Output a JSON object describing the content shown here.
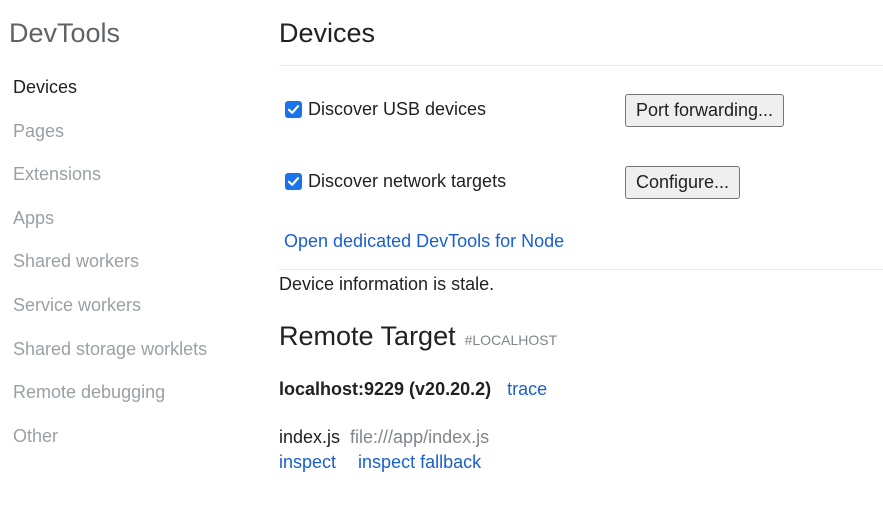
{
  "sidebar": {
    "title": "DevTools",
    "items": [
      {
        "label": "Devices",
        "selected": true
      },
      {
        "label": "Pages"
      },
      {
        "label": "Extensions"
      },
      {
        "label": "Apps"
      },
      {
        "label": "Shared workers"
      },
      {
        "label": "Service workers"
      },
      {
        "label": "Shared storage worklets"
      },
      {
        "label": "Remote debugging"
      },
      {
        "label": "Other"
      }
    ]
  },
  "main": {
    "title": "Devices",
    "usb": {
      "label": "Discover USB devices",
      "checked": true,
      "button": "Port forwarding..."
    },
    "network": {
      "label": "Discover network targets",
      "checked": true,
      "button": "Configure..."
    },
    "node_link": "Open dedicated DevTools for Node",
    "stale_text": "Device information is stale.",
    "remote": {
      "title": "Remote Target",
      "tag": "#LOCALHOST",
      "target_name": "localhost:9229 (v20.20.2)",
      "trace_link": "trace",
      "file_name": "index.js",
      "file_path": "file:///app/index.js",
      "inspect_link": "inspect",
      "inspect_fallback_link": "inspect fallback"
    }
  },
  "colors": {
    "accent": "#1a73e8",
    "link": "#1a5fcf",
    "muted": "#9aa0a6"
  }
}
